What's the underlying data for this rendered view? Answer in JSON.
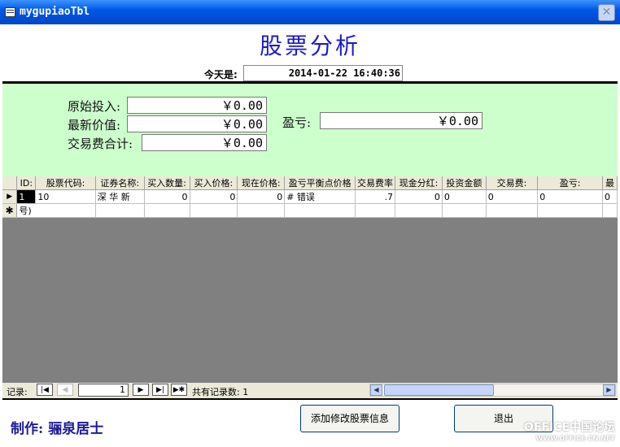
{
  "window": {
    "title": "mygupiaoTbl"
  },
  "header": {
    "title": "股票分析",
    "today_label": "今天是:",
    "today_value": "2014-01-22 16:40:36"
  },
  "summary": {
    "original_label": "原始投入:",
    "original_value": "￥0.00",
    "latest_label": "最新价值:",
    "latest_value": "￥0.00",
    "fee_label": "交易费合计:",
    "fee_value": "￥0.00",
    "profit_label": "盈亏:",
    "profit_value": "￥0.00"
  },
  "grid": {
    "columns": [
      "ID:",
      "股票代码:",
      "证券名称:",
      "买入数量:",
      "买入价格:",
      "现在价格:",
      "盈亏平衡点价格",
      "交易费率",
      "现金分红:",
      "投资金额",
      "交易费:",
      "盈亏:",
      "最"
    ],
    "rows": [
      [
        "1",
        "10",
        "深 华 新",
        "0",
        "0",
        "0",
        "# 错误",
        ".7",
        "0",
        "0",
        "0",
        "0",
        "0"
      ]
    ],
    "new_row_text": "号)"
  },
  "navigation": {
    "record_label": "记录:",
    "current_record": "1",
    "total_label": "共有记录数: 1"
  },
  "footer": {
    "author": "制作: 骊泉居士",
    "edit_button": "添加修改股票信息",
    "exit_button": "退出"
  },
  "watermark": {
    "main": "OFFICE中国论坛",
    "sub": "WWW.OFFICE-CN.NET"
  }
}
